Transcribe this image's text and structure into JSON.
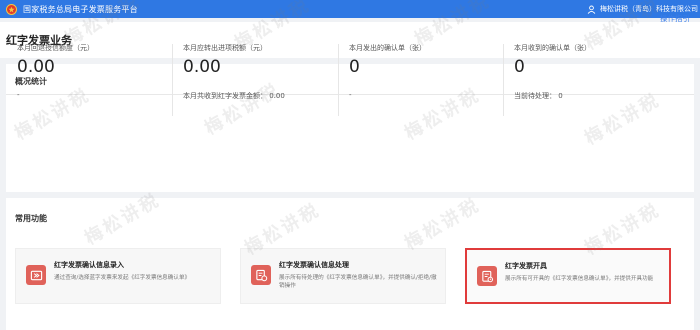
{
  "header": {
    "app_title": "国家税务总局电子发票服务平台",
    "user_name": "梅松讲税（青岛）科技有限公司"
  },
  "page": {
    "title": "红字发票业务",
    "guide_link": "操作指引"
  },
  "overview": {
    "section_title": "概况统计",
    "stats": [
      {
        "label": "本月回退授信额度（元）",
        "value": "0.00",
        "foot": "-"
      },
      {
        "label": "本月应转出进项税额（元）",
        "value": "0.00",
        "foot": "本月共收到红字发票金额：  0.00"
      },
      {
        "label": "本月发出的确认单（张）",
        "value": "0",
        "foot": "-"
      },
      {
        "label": "本月收到的确认单（张）",
        "value": "0",
        "foot": "当前待处理：  0"
      }
    ]
  },
  "common": {
    "section_title": "常用功能",
    "cards": [
      {
        "title": "红字发票确认信息录入",
        "desc": "通过查询/选择蓝字发票来发起《红字发票信息确认单》",
        "icon": "invoice-entry-icon"
      },
      {
        "title": "红字发票确认信息处理",
        "desc": "展示所有待处理的《红字发票信息确认单》，并提供确认/拒绝/撤销操作",
        "icon": "invoice-process-icon"
      },
      {
        "title": "红字发票开具",
        "desc": "展示所有可开具的《红字发票信息确认单》，并提供开具功能",
        "icon": "invoice-issue-icon"
      }
    ]
  },
  "watermark": "梅松讲税",
  "colors": {
    "topbar": "#2f78e3",
    "accent_red": "#e03b3b",
    "icon_bg": "#e0625a",
    "link": "#3b7de9"
  }
}
